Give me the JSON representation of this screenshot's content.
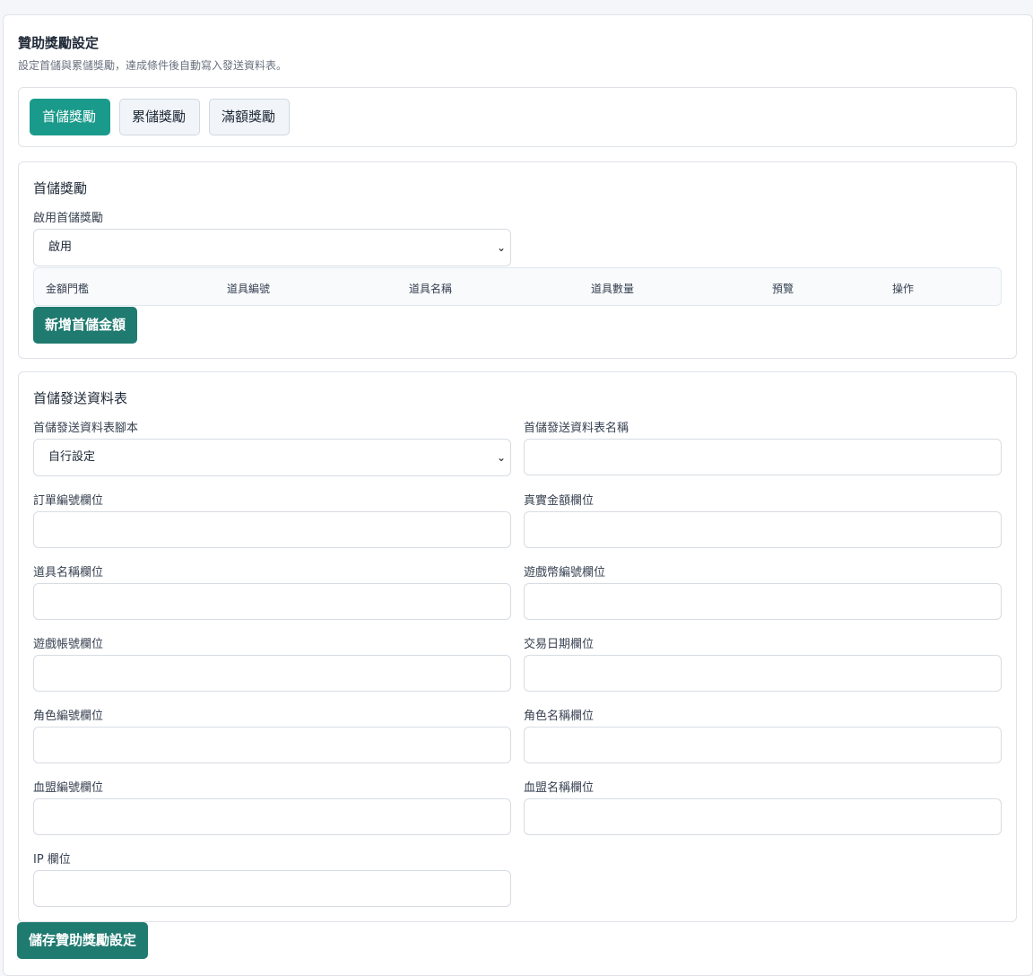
{
  "header": {
    "title": "贊助獎勵設定",
    "subtitle": "設定首儲與累儲獎勵，達成條件後自動寫入發送資料表。"
  },
  "tabs": [
    {
      "label": "首儲獎勵",
      "active": true
    },
    {
      "label": "累儲獎勵",
      "active": false
    },
    {
      "label": "滿額獎勵",
      "active": false
    }
  ],
  "first_deposit": {
    "title": "首儲獎勵",
    "enable_label": "啟用首儲獎勵",
    "enable_value": "啟用",
    "table_headers": [
      "金額門檻",
      "道具編號",
      "道具名稱",
      "道具數量",
      "預覽",
      "操作"
    ],
    "add_button": "新增首儲金額"
  },
  "sheet": {
    "title": "首儲發送資料表",
    "script_label": "首儲發送資料表腳本",
    "script_value": "自行設定",
    "sheet_name_label": "首儲發送資料表名稱",
    "fields": [
      "訂單編號欄位",
      "真實金額欄位",
      "道具名稱欄位",
      "遊戲幣編號欄位",
      "遊戲帳號欄位",
      "交易日期欄位",
      "角色編號欄位",
      "角色名稱欄位",
      "血盟編號欄位",
      "血盟名稱欄位",
      "IP 欄位"
    ]
  },
  "save_button": "儲存贊助獎勵設定",
  "colors": {
    "accent": "#1a9a8b",
    "button": "#1f7a70"
  }
}
